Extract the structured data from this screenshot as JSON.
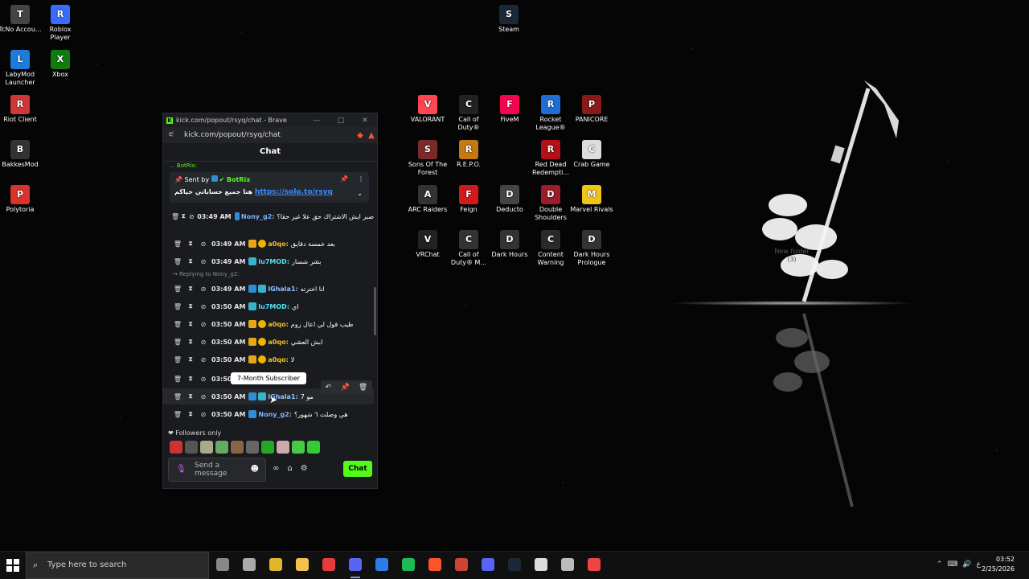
{
  "desktop_icons": [
    {
      "label": "TcNo Accou...",
      "icon": "tcno-icon",
      "color": "#444"
    },
    {
      "label": "Roblox Player",
      "icon": "roblox-icon",
      "color": "#3a6bff"
    },
    {
      "label": "LabyMod Launcher",
      "icon": "labymod-icon",
      "color": "#1e7bd8"
    },
    {
      "label": "Xbox",
      "icon": "xbox-icon",
      "color": "#107c10"
    },
    {
      "label": "Riot Client",
      "icon": "riot-icon",
      "color": "#d13639"
    },
    {
      "label": "BakkesMod",
      "icon": "bakkesmod-icon",
      "color": "#333"
    },
    {
      "label": "Polytoria",
      "icon": "polytoria-icon",
      "color": "#d9342b"
    },
    {
      "label": "Steam",
      "icon": "steam-icon",
      "color": "#1b2838"
    },
    {
      "label": "VALORANT",
      "icon": "valorant-icon",
      "color": "#ff4655"
    },
    {
      "label": "Call of Duty®",
      "icon": "cod-icon",
      "color": "#222"
    },
    {
      "label": "FiveM",
      "icon": "fivem-icon",
      "color": "#f40552"
    },
    {
      "label": "Rocket League®",
      "icon": "rocket-league-icon",
      "color": "#1e6ed8"
    },
    {
      "label": "PANICORE",
      "icon": "panicore-icon",
      "color": "#8a1a1a"
    },
    {
      "label": "Sons Of The Forest",
      "icon": "sotf-icon",
      "color": "#7a2a2a"
    },
    {
      "label": "R.E.P.O.",
      "icon": "repo-icon",
      "color": "#c47a12"
    },
    {
      "label": "Red Dead Redempti...",
      "icon": "rdr-icon",
      "color": "#b3101a"
    },
    {
      "label": "Crab Game",
      "icon": "crab-game-icon",
      "color": "#ddd"
    },
    {
      "label": "ARC Raiders",
      "icon": "arc-raiders-icon",
      "color": "#333"
    },
    {
      "label": "Feign",
      "icon": "feign-icon",
      "color": "#d31a1a"
    },
    {
      "label": "Deducto",
      "icon": "deducto-icon",
      "color": "#444"
    },
    {
      "label": "Double Shoulders",
      "icon": "double-shoulders-icon",
      "color": "#9b1c2a"
    },
    {
      "label": "Marvel Rivals",
      "icon": "marvel-rivals-icon",
      "color": "#f0c419"
    },
    {
      "label": "VRChat",
      "icon": "vrchat-icon",
      "color": "#222"
    },
    {
      "label": "Call of Duty® M...",
      "icon": "codm-icon",
      "color": "#333"
    },
    {
      "label": "Dark Hours",
      "icon": "dark-hours-icon",
      "color": "#333"
    },
    {
      "label": "Content Warning",
      "icon": "content-warning-icon",
      "color": "#2a2a2a"
    },
    {
      "label": "Dark Hours Prologue",
      "icon": "dark-hours-prologue-icon",
      "color": "#333"
    }
  ],
  "browser": {
    "title": "kick.com/popout/rsyq/chat - Brave",
    "url": "kick.com/popout/rsyq/chat",
    "chat_title": "Chat"
  },
  "pinned": {
    "sent_by_label": "Sent by",
    "bot_name": "BotRix",
    "text": "هنا جميع حساباتي حياكم",
    "link": "https://solo.to/rsyq"
  },
  "messages": [
    {
      "time": "03:49 AM",
      "user": "Nony_g2:",
      "user_color": "#7fb0ff",
      "badges": [
        "b-mod"
      ],
      "text": "صبر ايش الاشتراك حق علا غير حقا؟"
    },
    {
      "time": "03:49 AM",
      "user": "a0qo:",
      "user_color": "#f0c419",
      "badges": [
        "b-crown",
        "b-sub"
      ],
      "text": "بعد خمسة دقايق"
    },
    {
      "time": "03:49 AM",
      "user": "lu7MOD:",
      "user_color": "#53e0f0",
      "badges": [
        "b-vip"
      ],
      "text": "بشر شسار"
    },
    {
      "time": "03:49 AM",
      "user": "lGhala1:",
      "user_color": "#8fc0ff",
      "badges": [
        "b-mod",
        "b-vip"
      ],
      "text": "انا اخترته"
    },
    {
      "time": "03:50 AM",
      "user": "lu7MOD:",
      "user_color": "#53e0f0",
      "badges": [
        "b-vip"
      ],
      "text": "اي"
    },
    {
      "time": "03:50 AM",
      "user": "a0qo:",
      "user_color": "#f0c419",
      "badges": [
        "b-crown",
        "b-sub"
      ],
      "text": "طيب قول لي اعال زوم"
    },
    {
      "time": "03:50 AM",
      "user": "a0qo:",
      "user_color": "#f0c419",
      "badges": [
        "b-crown",
        "b-sub"
      ],
      "text": "ابش العشي"
    },
    {
      "time": "03:50 AM",
      "user": "a0qo:",
      "user_color": "#f0c419",
      "badges": [
        "b-crown",
        "b-sub"
      ],
      "text": "لا"
    },
    {
      "time": "03:50",
      "user": "",
      "user_color": "#fff",
      "badges": [],
      "text": ""
    },
    {
      "time": "03:50 AM",
      "user": "lGhala1:",
      "user_color": "#8fc0ff",
      "badges": [
        "b-mod",
        "b-vip"
      ],
      "text": "مو 7"
    },
    {
      "time": "03:50 AM",
      "user": "Nony_g2:",
      "user_color": "#7fb0ff",
      "badges": [
        "b-mod"
      ],
      "text": "هي وصلت ٦ شهور؟"
    }
  ],
  "reply_text": "Replying to Nony_g2:",
  "tooltip": "7-Month Subscriber",
  "followers_only": "Followers only",
  "composer": {
    "placeholder_line1": "Send a",
    "placeholder_line2": "message",
    "chat_button": "Chat"
  },
  "wallpaper_note": "New folder (3)",
  "taskbar": {
    "search_placeholder": "Type here to search",
    "time": "03:52",
    "date": "2/25/2026",
    "lang": "ع"
  },
  "colors": {
    "kick_green": "#53fc18",
    "link_blue": "#3b8cff"
  }
}
